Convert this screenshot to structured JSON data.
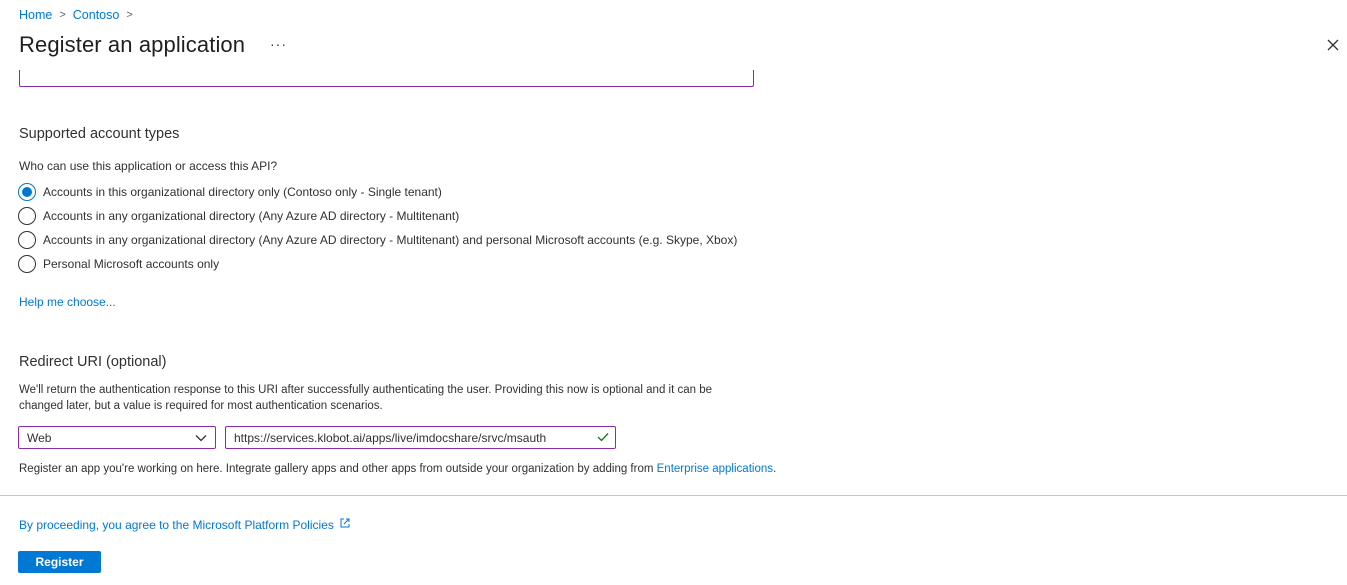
{
  "breadcrumb": {
    "items": [
      "Home",
      "Contoso"
    ]
  },
  "header": {
    "title": "Register an application",
    "more_label": "···"
  },
  "account_types": {
    "heading": "Supported account types",
    "question": "Who can use this application or access this API?",
    "options": [
      "Accounts in this organizational directory only (Contoso only - Single tenant)",
      "Accounts in any organizational directory (Any Azure AD directory - Multitenant)",
      "Accounts in any organizational directory (Any Azure AD directory - Multitenant) and personal Microsoft accounts (e.g. Skype, Xbox)",
      "Personal Microsoft accounts only"
    ],
    "selected_index": 0,
    "help_link": "Help me choose..."
  },
  "redirect": {
    "heading": "Redirect URI (optional)",
    "description": "We'll return the authentication response to this URI after successfully authenticating the user. Providing this now is optional and it can be changed later, but a value is required for most authentication scenarios.",
    "platform_value": "Web",
    "uri_value": "https://services.klobot.ai/apps/live/imdocshare/srvc/msauth"
  },
  "note": {
    "text": "Register an app you're working on here. Integrate gallery apps and other apps from outside your organization by adding from ",
    "link": "Enterprise applications",
    "suffix": "."
  },
  "footer": {
    "policy_link": "By proceeding, you agree to the Microsoft Platform Policies",
    "register_label": "Register"
  },
  "colors": {
    "accent": "#0078d4",
    "input_border": "#8a2da5",
    "valid_check": "#107c10"
  }
}
